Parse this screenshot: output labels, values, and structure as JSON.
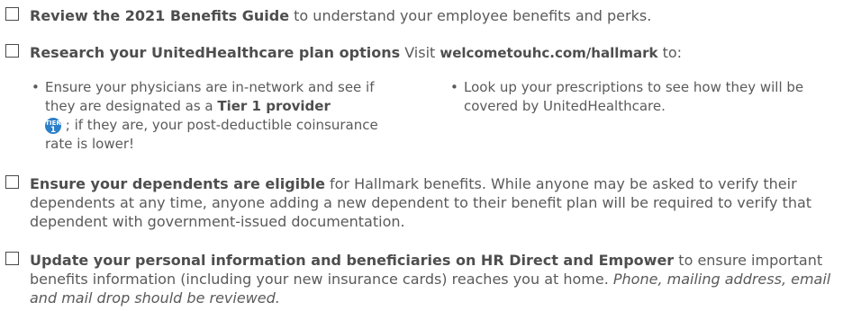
{
  "items": [
    {
      "bold": "Review the 2021 Benefits Guide",
      "rest": " to understand your employee benefits and perks."
    },
    {
      "bold": "Research your UnitedHealthcare plan options",
      "pre_link": " Visit ",
      "link": "welcometouhc.com/hallmark",
      "post_link": " to:",
      "bullets": [
        {
          "a": "Ensure your physicians are in-network and see if they are designated as a ",
          "strong": "Tier 1 provider",
          "icon": "tier-1-icon",
          "icon_top": "TIER",
          "icon_num": "1",
          "b": " ; if they are, your post-deductible coinsurance rate is lower!"
        },
        {
          "a": "Look up your prescriptions to see how they will be covered by UnitedHealthcare."
        }
      ]
    },
    {
      "bold": "Ensure your dependents are eligible",
      "rest": " for Hallmark benefits. While anyone may be asked to verify their dependents at any time, anyone adding a new dependent to their benefit plan will be required to verify that dependent with government-issued documentation."
    },
    {
      "bold": "Update your personal information and beneficiaries on HR Direct and Empower",
      "rest": " to ensure important benefits information (including your new insurance cards) reaches you at home. ",
      "italic": "Phone, mailing address, email and mail drop should be reviewed."
    }
  ]
}
